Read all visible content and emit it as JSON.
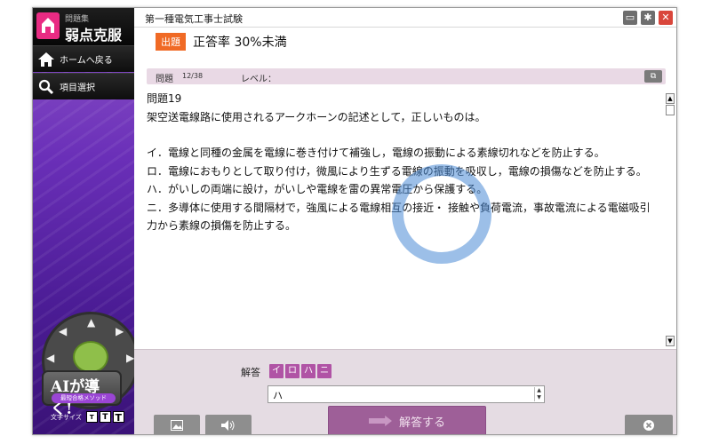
{
  "brand": {
    "sub": "問題集",
    "main": "弱点克服"
  },
  "nav": {
    "home": "ホームへ戻る",
    "items": "項目選択"
  },
  "sidebar_misc": {
    "ai_title": "AIが導く!",
    "ai_tagline": "最短合格メソッド",
    "font_size_label": "文字サイズ",
    "font_sizes": [
      "T",
      "T",
      "T"
    ]
  },
  "window": {
    "title": "第一種電気工事士試験"
  },
  "category": {
    "badge": "出題",
    "text": "正答率 30%未満"
  },
  "question_header": {
    "label": "問題",
    "number": "12/38",
    "level_label": "レベル："
  },
  "question": {
    "title": "問題19",
    "prompt": "架空送電線路に使用されるアークホーンの記述として，正しいものは。",
    "options": [
      "イ．電線と同種の金属を電線に巻き付けて補強し，電線の振動による素線切れなどを防止する。",
      "ロ．電線におもりとして取り付け，微風により生ずる電線の振動を吸収し，電線の損傷などを防止する。",
      "ハ．がいしの両端に設け，がいしや電線を雷の異常電圧から保護する。",
      "ニ．多導体に使用する間隔材で，強風による電線相互の接近・ 接触や負荷電流，事故電流による電磁吸引力から素線の損傷を防止する。"
    ]
  },
  "answer": {
    "label": "解答",
    "choices": [
      "イ",
      "ロ",
      "ハ",
      "ニ"
    ],
    "value": "ハ",
    "submit_label": "解答する"
  },
  "colors": {
    "accent": "#b053a5",
    "badge": "#f06a25",
    "ring": "#4b8bd6"
  }
}
